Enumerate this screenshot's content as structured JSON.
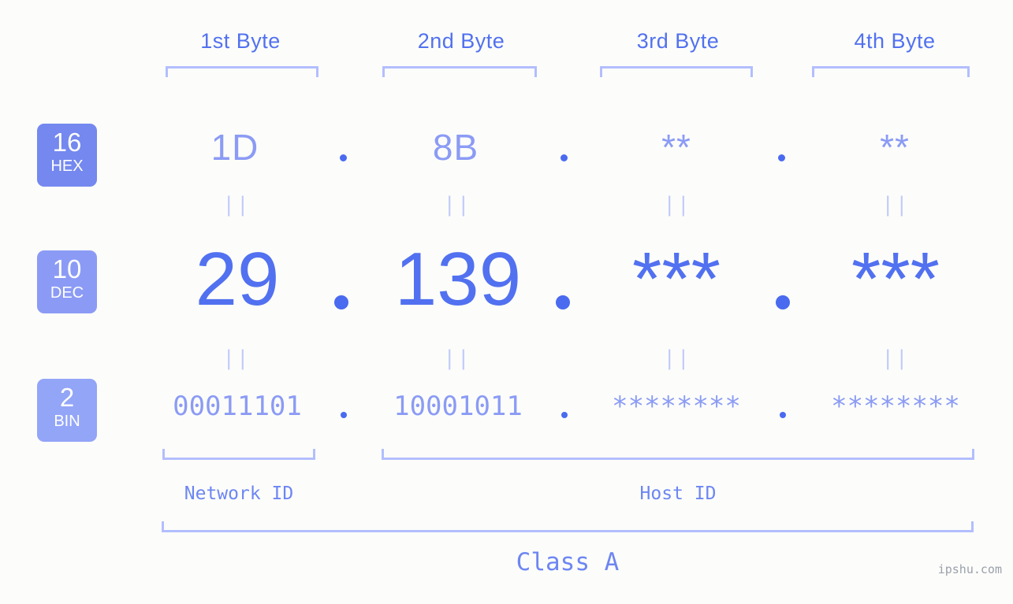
{
  "background_color": "#fcfdfa",
  "accent_strong": "#5271f0",
  "accent_mid": "#8b9bf5",
  "accent_light": "#b3beff",
  "byte_headers": [
    {
      "label": "1st Byte"
    },
    {
      "label": "2nd Byte"
    },
    {
      "label": "3rd Byte"
    },
    {
      "label": "4th Byte"
    }
  ],
  "bases": [
    {
      "number": "16",
      "name": "HEX",
      "color": "#7488ef"
    },
    {
      "number": "10",
      "name": "DEC",
      "color": "#8b9bf5"
    },
    {
      "number": "2",
      "name": "BIN",
      "color": "#93a5f7"
    }
  ],
  "rows": {
    "hex": {
      "base_number": "16",
      "base_name": "HEX",
      "values": [
        "1D",
        "8B",
        "**",
        "**"
      ],
      "separator": "."
    },
    "dec": {
      "base_number": "10",
      "base_name": "DEC",
      "values": [
        "29",
        "139",
        "***",
        "***"
      ],
      "separator": "."
    },
    "bin": {
      "base_number": "2",
      "base_name": "BIN",
      "values": [
        "00011101",
        "10001011",
        "********",
        "********"
      ],
      "separator": "."
    }
  },
  "equality_marks": {
    "symbol": "||",
    "rows": [
      "hex-to-dec",
      "dec-to-bin"
    ]
  },
  "id_sections": [
    {
      "label": "Network ID"
    },
    {
      "label": "Host ID"
    }
  ],
  "class": {
    "label": "Class A"
  },
  "watermark": {
    "text": "ipshu.com"
  }
}
